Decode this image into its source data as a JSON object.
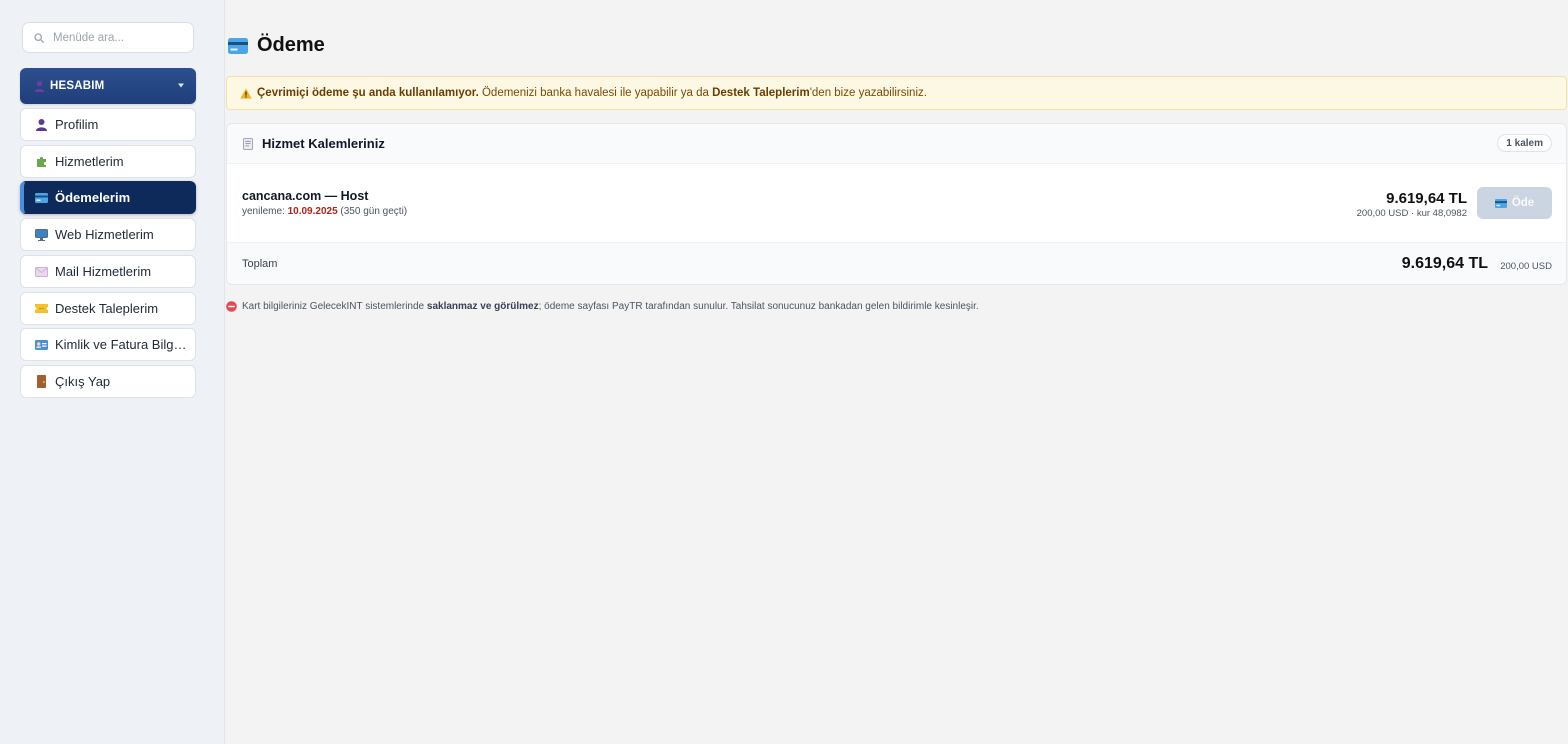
{
  "sidebar": {
    "search_placeholder": "Menüde ara...",
    "section_label": "HESABIM",
    "items": [
      {
        "label": "Profilim",
        "icon": "user-icon"
      },
      {
        "label": "Hizmetlerim",
        "icon": "puzzle-icon"
      },
      {
        "label": "Ödemelerim",
        "icon": "credit-card-icon",
        "active": true
      },
      {
        "label": "Web Hizmetlerim",
        "icon": "monitor-icon"
      },
      {
        "label": "Mail Hizmetlerim",
        "icon": "envelope-icon"
      },
      {
        "label": "Destek Taleplerim",
        "icon": "ticket-icon"
      },
      {
        "label": "Kimlik ve Fatura Bilgileri",
        "icon": "id-card-icon"
      },
      {
        "label": "Çıkış Yap",
        "icon": "door-icon"
      }
    ]
  },
  "main": {
    "title": "Ödeme",
    "alert": {
      "strong": "Çevrimiçi ödeme şu anda kullanılamıyor.",
      "text_before": " Ödemenizi banka havalesi ile yapabilir ya da ",
      "link": "Destek Taleplerim",
      "text_after": "'den bize yazabilirsiniz."
    },
    "card": {
      "title": "Hizmet Kalemleriniz",
      "count_badge": "1 kalem",
      "items": [
        {
          "name": "cancana.com — Host",
          "renew_prefix": "yenileme: ",
          "renew_date": "10.09.2025",
          "renew_note": " (350 gün geçti)",
          "price": "9.619,64 TL",
          "price_detail": "200,00 USD · kur 48,0982",
          "pay_label": "Öde"
        }
      ],
      "total_label": "Toplam",
      "total_value": "9.619,64 TL",
      "total_usd": "200,00 USD"
    },
    "note": {
      "before": "Kart bilgileriniz GelecekINT sistemlerinde ",
      "strong": "saklanmaz ve görülmez",
      "after": "; ödeme sayfası PayTR tarafından sunulur. Tahsilat sonucunuz bankadan gelen bildirimle kesinleşir."
    }
  },
  "colors": {
    "sidebar_bg": "#eef1f6",
    "header_blue": "#1f3f7a",
    "active_navy": "#0e2a5a",
    "active_accent": "#4b8de0",
    "alert_bg": "#fdf8e4",
    "renew_red": "#b42318",
    "pay_disabled": "#cbd5e1"
  }
}
